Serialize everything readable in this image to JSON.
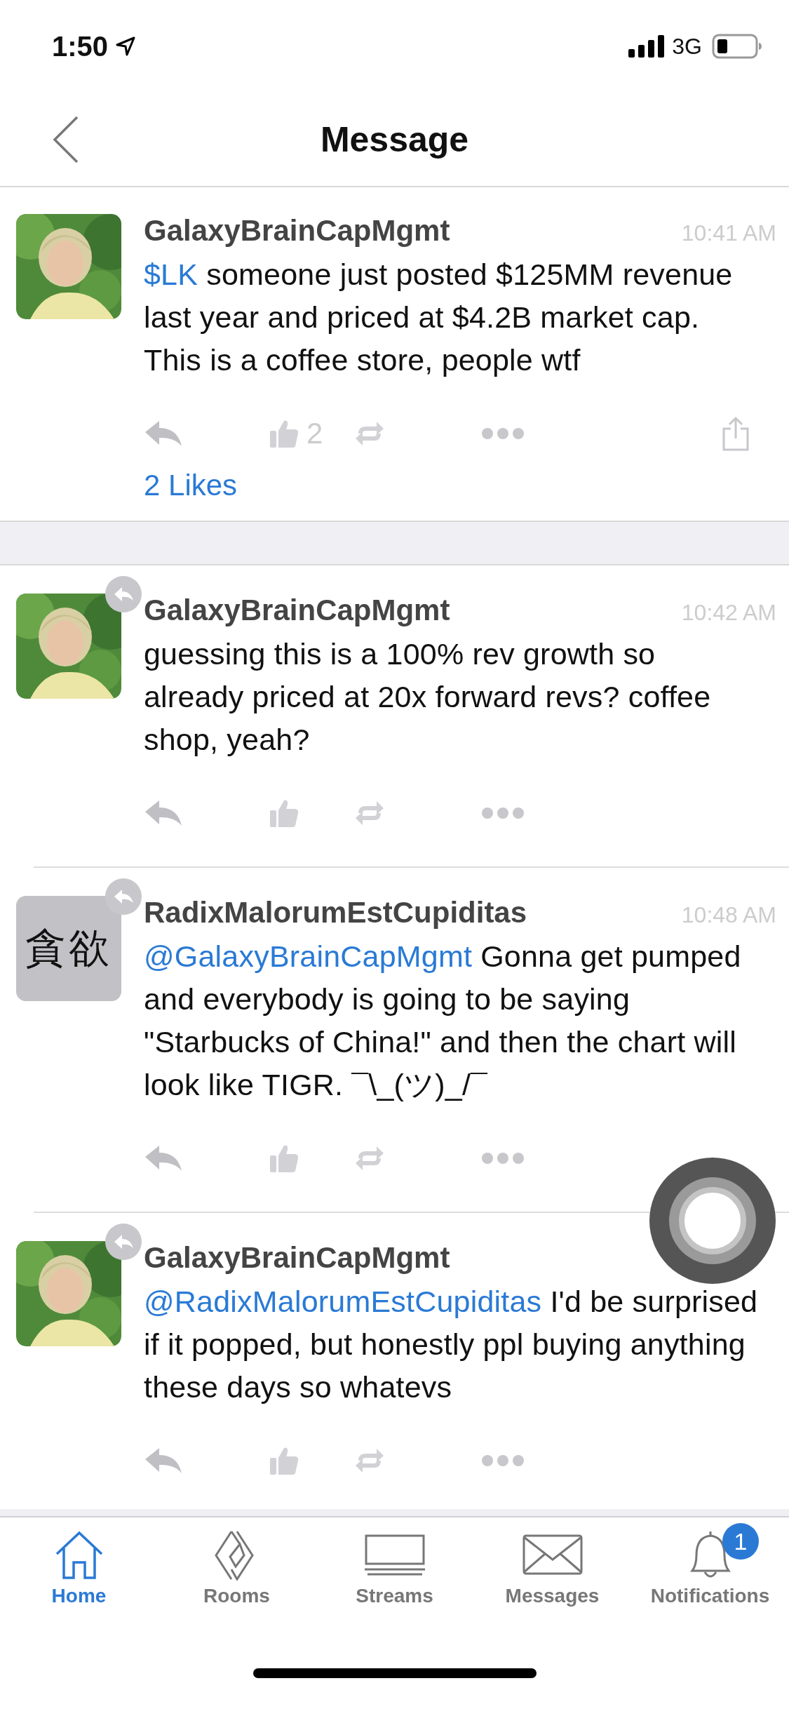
{
  "status_bar": {
    "time": "1:50",
    "network": "3G"
  },
  "nav": {
    "title": "Message"
  },
  "posts": [
    {
      "kind": "main",
      "author": "GalaxyBrainCapMgmt",
      "time": "10:41 AM",
      "is_reply": false,
      "mention": "$LK",
      "text": "someone just posted $125MM revenue last year and priced at $4.2B market cap. This is a coffee store, people wtf",
      "like_count": "2",
      "share": true,
      "likes_summary": "2 Likes"
    },
    {
      "kind": "reply",
      "author": "GalaxyBrainCapMgmt",
      "time": "10:42 AM",
      "is_reply": true,
      "text": "guessing this is a 100% rev growth so already priced at 20x forward revs? coffee shop, yeah?",
      "share": false
    },
    {
      "kind": "reply",
      "author": "RadixMalorumEstCupiditas",
      "time": "10:48 AM",
      "avatar": {
        "kind": "text",
        "text": "貪欲"
      },
      "is_reply": true,
      "mention": "@GalaxyBrainCapMgmt",
      "text": "Gonna get pumped and everybody is going to be saying \"Starbucks of China!\" and then the chart will look like TIGR.  ¯\\_(ツ)_/¯",
      "share": false
    },
    {
      "kind": "reply",
      "author": "GalaxyBrainCapMgmt",
      "is_reply": true,
      "mention": "@RadixMalorumEstCupiditas",
      "text": "I'd be surprised if it popped, but honestly ppl buying anything these days so whatevs",
      "share": false
    }
  ],
  "tabs": [
    {
      "kind": "home",
      "label": "Home",
      "selected": true
    },
    {
      "kind": "rooms",
      "label": "Rooms",
      "selected": false
    },
    {
      "kind": "streams",
      "label": "Streams",
      "selected": false
    },
    {
      "kind": "messages",
      "label": "Messages",
      "selected": false
    },
    {
      "kind": "notifications",
      "label": "Notifications",
      "selected": false,
      "badge": "1"
    }
  ]
}
